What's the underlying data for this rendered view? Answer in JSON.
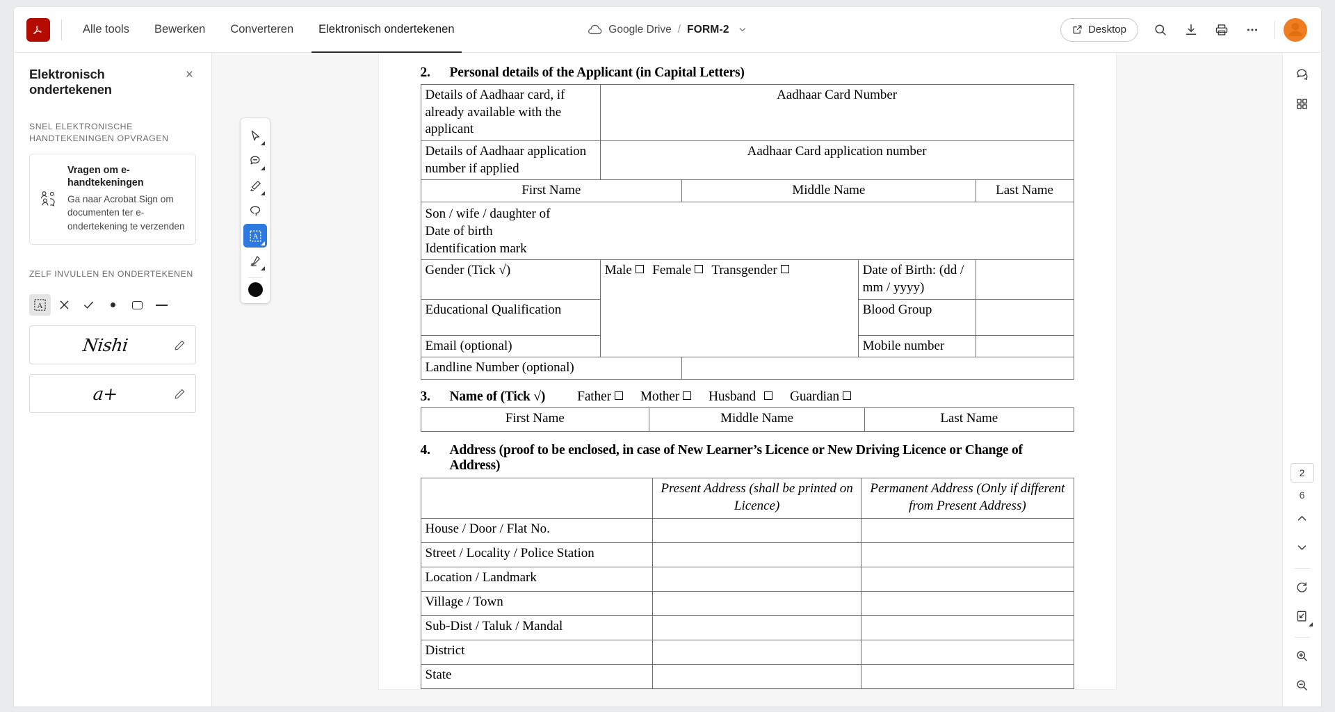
{
  "app": {
    "logo_name": "acrobat-logo",
    "accent_blue": "#2c7ae0",
    "brand_red": "#b30b00",
    "avatar_orange": "#ef7d22"
  },
  "topbar": {
    "tabs": [
      {
        "label": "Alle tools",
        "active": false
      },
      {
        "label": "Bewerken",
        "active": false
      },
      {
        "label": "Converteren",
        "active": false
      },
      {
        "label": "Elektronisch ondertekenen",
        "active": true
      }
    ],
    "breadcrumb": {
      "storage": "Google Drive",
      "separator": "/",
      "filename": "FORM-2"
    },
    "desktop_button": "Desktop",
    "icons": [
      "search-icon",
      "download-icon",
      "print-icon",
      "more-options-icon",
      "avatar"
    ]
  },
  "left_panel": {
    "title": "Elektronisch ondertekenen",
    "close": "×",
    "section1_label": "SNEL ELEKTRONISCHE HANDTEKENINGEN OPVRAGEN",
    "promo": {
      "title": "Vragen om e-handtekeningen",
      "description": "Ga naar Acrobat Sign om documenten ter e-ondertekening te verzenden",
      "icon": "request-signature-icon"
    },
    "section2_label": "ZELF INVULLEN EN ONDERTEKENEN",
    "fill_tools": [
      {
        "name": "add-text-tool",
        "glyph": "A",
        "selected": true
      },
      {
        "name": "cross-mark-tool",
        "glyph": "✕",
        "selected": false
      },
      {
        "name": "check-mark-tool",
        "glyph": "✓",
        "selected": false
      },
      {
        "name": "dot-tool",
        "glyph": "●",
        "selected": false
      },
      {
        "name": "rectangle-tool",
        "glyph": "□",
        "selected": false
      },
      {
        "name": "line-tool",
        "glyph": "—",
        "selected": false
      }
    ],
    "signatures": [
      {
        "name": "Nishi"
      },
      {
        "name": "a+"
      }
    ]
  },
  "vertical_toolbar": {
    "tools": [
      {
        "name": "select-cursor-tool",
        "active": false,
        "has_caret": true
      },
      {
        "name": "comment-tool",
        "active": false,
        "has_caret": true
      },
      {
        "name": "highlight-tool",
        "active": false,
        "has_caret": true
      },
      {
        "name": "lasso-draw-tool",
        "active": false,
        "has_caret": false
      },
      {
        "name": "add-text-field-tool",
        "active": true,
        "has_caret": true
      },
      {
        "name": "sign-tool",
        "active": false,
        "has_caret": true
      }
    ],
    "color_swatch": "#0a0a0a"
  },
  "right_rail": {
    "top_icons": [
      "comment-panel-icon",
      "all-tools-grid-icon"
    ],
    "page_current": "2",
    "page_total": "6",
    "nav": [
      "previous-page-icon",
      "next-page-icon"
    ],
    "bottom_icons": [
      "rotate-page-icon",
      "fit-page-icon",
      "zoom-in-icon",
      "zoom-out-icon"
    ]
  },
  "document": {
    "section2": {
      "number": "2.",
      "title": "Personal details of the Applicant (in Capital Letters)",
      "rows": {
        "aadhaar_label": "Details of Aadhaar card, if already available with the applicant",
        "aadhaar_value_header": "Aadhaar Card Number",
        "aadhaar_app_label": "Details of Aadhaar application number if applied",
        "aadhaar_app_value_header": "Aadhaar Card application number",
        "name_headers": [
          "First Name",
          "Middle Name",
          "Last Name"
        ],
        "relation_lines": [
          "Son / wife / daughter of",
          "Date of birth",
          "Identification mark"
        ],
        "gender_label": "Gender (Tick √)",
        "gender_options": [
          "Male",
          "Female",
          "Transgender"
        ],
        "dob_label": "Date of Birth: (dd / mm / yyyy)",
        "education_label": "Educational Qualification",
        "blood_group_label": "Blood Group",
        "email_label": "Email (optional)",
        "mobile_label": "Mobile number",
        "landline_label": "Landline Number (optional)"
      }
    },
    "section3": {
      "number": "3.",
      "title": "Name of (Tick √)",
      "options": [
        "Father",
        "Mother",
        "Husband",
        "Guardian"
      ],
      "name_headers": [
        "First Name",
        "Middle Name",
        "Last Name"
      ]
    },
    "section4": {
      "number": "4.",
      "title": "Address (proof to be enclosed, in case of New Learner’s Licence or New Driving Licence or Change of Address)",
      "col_headers": [
        "",
        "Present Address (shall be printed on Licence)",
        "Permanent Address (Only if different from Present Address)"
      ],
      "rows": [
        "House / Door / Flat No.",
        "Street / Locality / Police Station",
        "Location / Landmark",
        "Village / Town",
        "Sub-Dist / Taluk / Mandal",
        "District",
        "State"
      ]
    }
  }
}
